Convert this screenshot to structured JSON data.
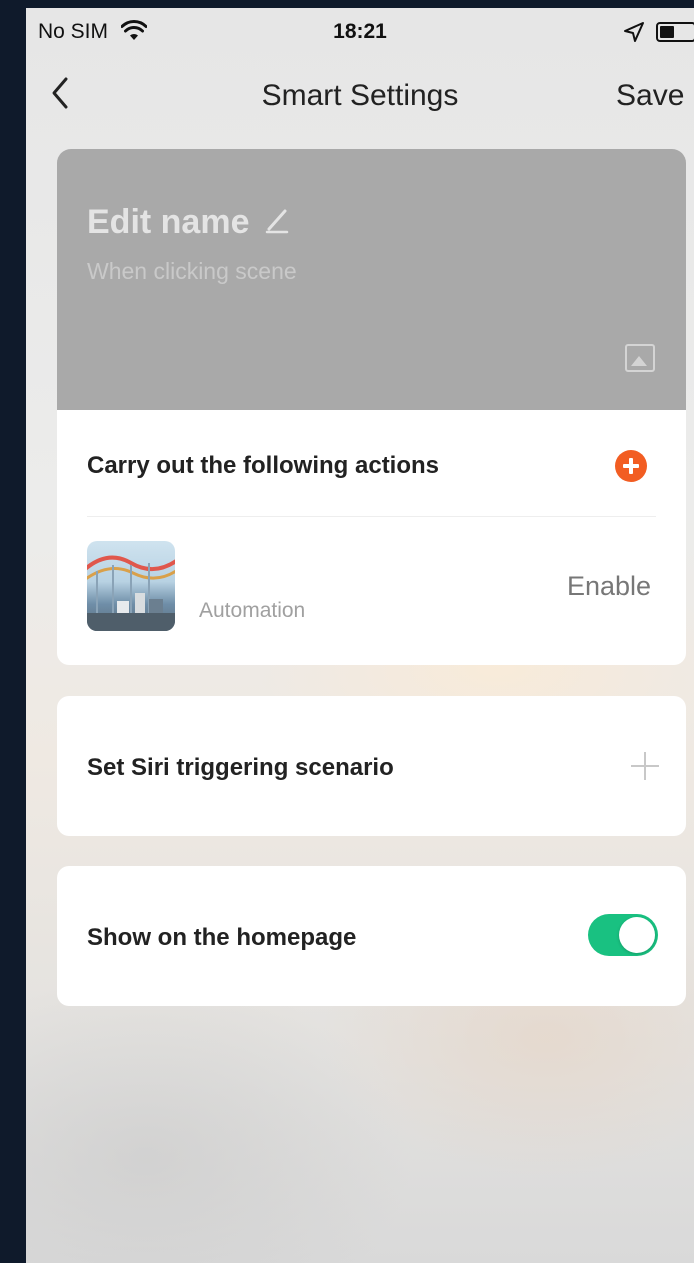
{
  "status_bar": {
    "carrier": "No SIM",
    "time": "18:21"
  },
  "nav": {
    "title": "Smart Settings",
    "save_label": "Save"
  },
  "header": {
    "name": "Edit name",
    "subtitle": "When clicking  scene"
  },
  "actions": {
    "heading": "Carry out the following actions",
    "items": [
      {
        "subtitle": "Automation",
        "status": "Enable"
      }
    ]
  },
  "siri": {
    "label": "Set Siri triggering scenario"
  },
  "homepage": {
    "label": "Show on the homepage",
    "enabled": true
  },
  "colors": {
    "accent_add": "#f25d22",
    "toggle_on": "#19c181"
  }
}
